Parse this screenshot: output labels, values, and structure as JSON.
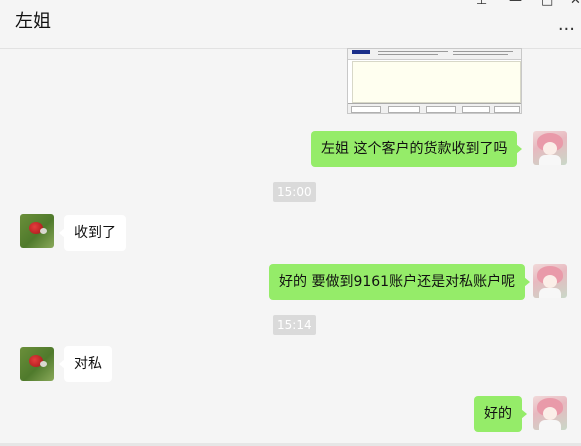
{
  "header": {
    "title": "左姐",
    "pin_icon": "pin-icon",
    "minimize_icon": "minimize-icon",
    "maximize_icon": "maximize-icon",
    "close_icon": "close-icon",
    "more_label": "..."
  },
  "messages": [
    {
      "type": "image",
      "side": "out",
      "content": "screenshot-image"
    },
    {
      "type": "text",
      "side": "out",
      "text": "左姐  这个客户的货款收到了吗"
    },
    {
      "type": "time",
      "text": "15:00"
    },
    {
      "type": "text",
      "side": "in",
      "text": "收到了"
    },
    {
      "type": "text",
      "side": "out",
      "text": "好的 要做到9161账户还是对私账户呢"
    },
    {
      "type": "time",
      "text": "15:14"
    },
    {
      "type": "text",
      "side": "in",
      "text": "对私"
    },
    {
      "type": "text",
      "side": "out",
      "text": "好的"
    }
  ],
  "colors": {
    "outgoing_bubble": "#95ec69",
    "incoming_bubble": "#ffffff",
    "background": "#f5f5f5",
    "time_badge": "#dadada"
  }
}
